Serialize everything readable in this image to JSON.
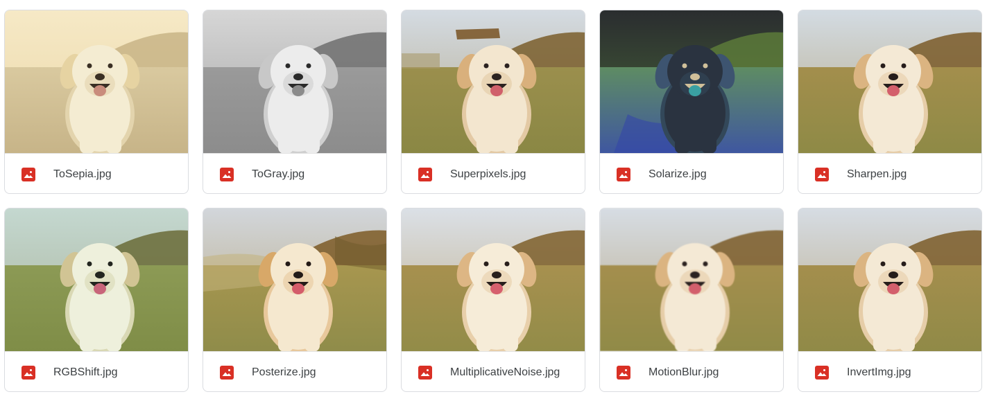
{
  "files": [
    {
      "name": "ToSepia.jpg",
      "filter": "sepia"
    },
    {
      "name": "ToGray.jpg",
      "filter": "gray"
    },
    {
      "name": "Superpixels.jpg",
      "filter": "superpixels"
    },
    {
      "name": "Solarize.jpg",
      "filter": "solarize"
    },
    {
      "name": "Sharpen.jpg",
      "filter": "sharpen"
    },
    {
      "name": "RGBShift.jpg",
      "filter": "rgbshift"
    },
    {
      "name": "Posterize.jpg",
      "filter": "posterize"
    },
    {
      "name": "MultiplicativeNoise.jpg",
      "filter": "noise"
    },
    {
      "name": "MotionBlur.jpg",
      "filter": "blur"
    },
    {
      "name": "InvertImg.jpg",
      "filter": "invert"
    }
  ],
  "icon": "image-file-icon",
  "colors": {
    "image_icon": "#d93025"
  }
}
